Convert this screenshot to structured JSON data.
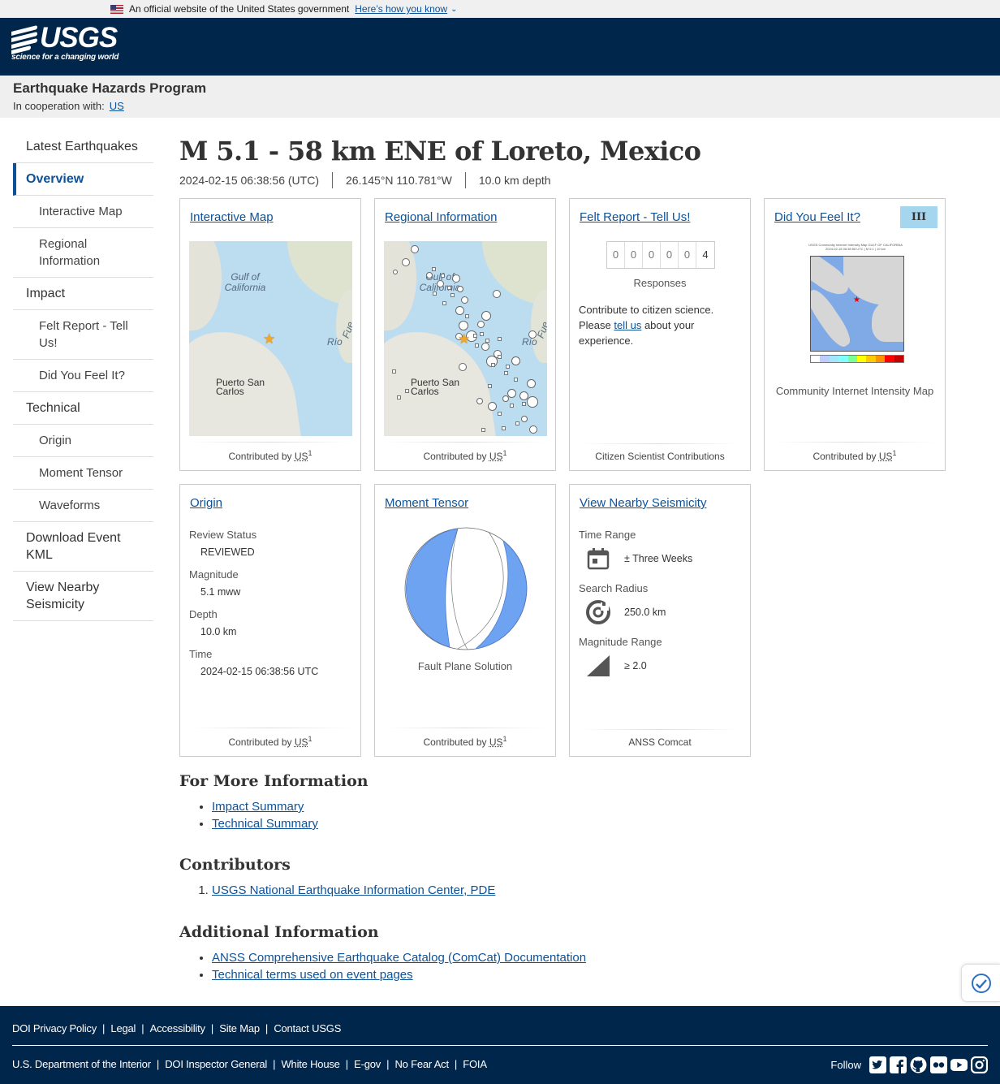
{
  "gov_banner": {
    "text": "An official website of the United States government",
    "link": "Here’s how you know"
  },
  "header": {
    "logo_text": "USGS",
    "logo_tagline": "science for a changing world"
  },
  "program": {
    "title": "Earthquake Hazards Program",
    "coop_label": "In cooperation with:",
    "coop_link": "US"
  },
  "sidebar": {
    "items": [
      {
        "label": "Latest Earthquakes"
      },
      {
        "label": "Overview"
      },
      {
        "label": "Interactive Map"
      },
      {
        "label": "Regional Information"
      },
      {
        "label": "Impact"
      },
      {
        "label": "Felt Report - Tell Us!"
      },
      {
        "label": "Did You Feel It?"
      },
      {
        "label": "Technical"
      },
      {
        "label": "Origin"
      },
      {
        "label": "Moment Tensor"
      },
      {
        "label": "Waveforms"
      },
      {
        "label": "Download Event KML"
      },
      {
        "label": "View Nearby Seismicity"
      }
    ]
  },
  "event": {
    "title": "M 5.1 - 58 km ENE of Loreto, Mexico",
    "time": "2024-02-15 06:38:56 (UTC)",
    "coords": "26.145°N 110.781°W",
    "depth": "10.0 km depth"
  },
  "cards": {
    "interactive_map": {
      "title": "Interactive Map",
      "contributed": "Contributed by",
      "network": "US",
      "sup": "1",
      "labels": {
        "gulf": "Gulf of California",
        "rio": "Río",
        "fue": "Fue",
        "city": "Puerto San Carlos"
      }
    },
    "regional": {
      "title": "Regional Information",
      "contributed": "Contributed by",
      "network": "US",
      "sup": "1",
      "labels": {
        "gulf": "Gulf of California",
        "rio": "Río",
        "fue": "Fue",
        "city": "Puerto San Carlos"
      }
    },
    "felt": {
      "title": "Felt Report - Tell Us!",
      "digits": [
        "0",
        "0",
        "0",
        "0",
        "0",
        "4"
      ],
      "responses": "Responses",
      "text_before": "Contribute to citizen science. Please ",
      "text_link": "tell us",
      "text_after": " about your experience.",
      "footer": "Citizen Scientist Contributions"
    },
    "dyfi": {
      "title": "Did You Feel It?",
      "intensity": "III",
      "caption": "Community Internet Intensity Map",
      "contributed": "Contributed by",
      "network": "US",
      "sup": "1",
      "map_header": "USGS Community Internet Intensity Map GULF OF CALIFORNIA",
      "map_sub": "2024-02-15 06:38:56 UTC | M 5.1 | 10 km"
    },
    "origin": {
      "title": "Origin",
      "fields": [
        {
          "label": "Review Status",
          "value": "REVIEWED"
        },
        {
          "label": "Magnitude",
          "value": "5.1 mww"
        },
        {
          "label": "Depth",
          "value": "10.0 km"
        },
        {
          "label": "Time",
          "value": "2024-02-15 06:38:56 UTC"
        }
      ],
      "contributed": "Contributed by",
      "network": "US",
      "sup": "1"
    },
    "moment_tensor": {
      "title": "Moment Tensor",
      "caption": "Fault Plane Solution",
      "contributed": "Contributed by",
      "network": "US",
      "sup": "1"
    },
    "nearby": {
      "title": "View Nearby Seismicity",
      "time_label": "Time Range",
      "time_value": "± Three Weeks",
      "radius_label": "Search Radius",
      "radius_value": "250.0 km",
      "mag_label": "Magnitude Range",
      "mag_value": "≥ 2.0",
      "footer": "ANSS Comcat"
    }
  },
  "more_info": {
    "title": "For More Information",
    "links": [
      "Impact Summary",
      "Technical Summary"
    ]
  },
  "contributors": {
    "title": "Contributors",
    "links": [
      "USGS National Earthquake Information Center, PDE"
    ]
  },
  "additional": {
    "title": "Additional Information",
    "links": [
      "ANSS Comprehensive Earthquake Catalog (ComCat) Documentation",
      "Technical terms used on event pages"
    ]
  },
  "footer": {
    "row1": [
      "DOI Privacy Policy",
      "Legal",
      "Accessibility",
      "Site Map",
      "Contact USGS"
    ],
    "row2": [
      "U.S. Department of the Interior",
      "DOI Inspector General",
      "White House",
      "E-gov",
      "No Fear Act",
      "FOIA"
    ],
    "follow": "Follow",
    "social_icons": [
      "twitter-icon",
      "facebook-icon",
      "github-icon",
      "flickr-icon",
      "youtube-icon",
      "instagram-icon"
    ]
  },
  "colors": {
    "header_bg": "#00264c",
    "link": "#0d5197",
    "intensity_III": "#a5d6ee",
    "mt_fill": "#6ea3f2"
  }
}
